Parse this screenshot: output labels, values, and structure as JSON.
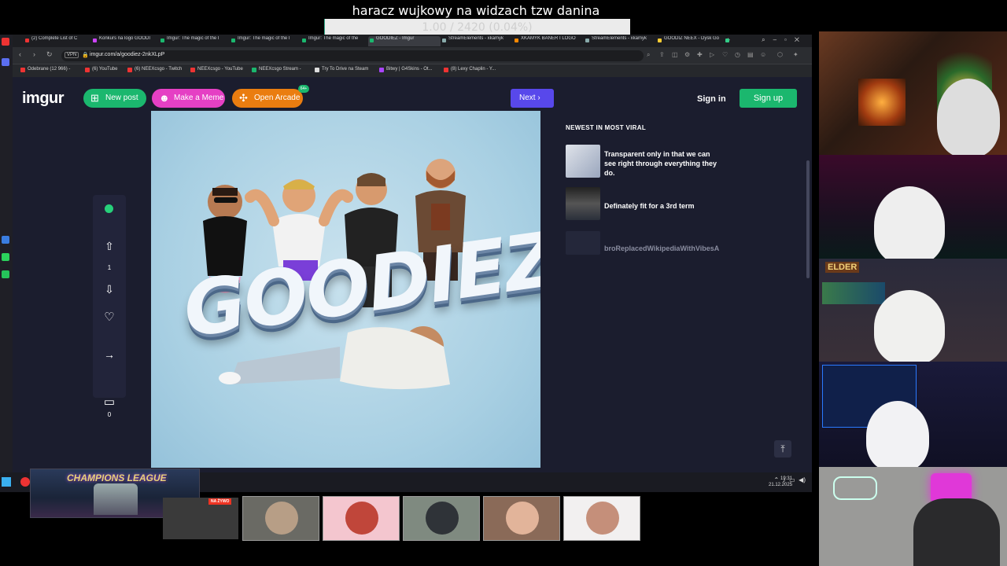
{
  "overlay": {
    "title": "haracz wujkowy na widzach tzw danina",
    "goal": "1.00 / 2420 (0.04%)",
    "goal_fraction": 0.0004
  },
  "browser": {
    "tabs": [
      {
        "label": "(2) Complete List of C"
      },
      {
        "label": "Konkurs na logo GOODI"
      },
      {
        "label": "Imgur: The magic of the I"
      },
      {
        "label": "Imgur: The magic of the I"
      },
      {
        "label": "Imgur: The magic of the"
      },
      {
        "label": "GOODIEZ - Imgur"
      },
      {
        "label": "StreamElements - xkamyk"
      },
      {
        "label": "XKAMYK BANER I LOGO"
      },
      {
        "label": "StreamElements - xkamyk"
      },
      {
        "label": "GOODIZ NEEX - Dysk Go"
      }
    ],
    "vpn_label": "VPN",
    "url": "imgur.com/a/goodiez-2nkXLpP",
    "bookmarks": [
      {
        "label": "Odebrane (12 966) -"
      },
      {
        "label": "(6) YouTube"
      },
      {
        "label": "(6) NEEXcsgo - Twitch"
      },
      {
        "label": "NEEXcsgo - YouTube"
      },
      {
        "label": "NEEXcsgo Stream -"
      },
      {
        "label": "Try To Drive na Steam"
      },
      {
        "label": "Bitwy | G4Skins - Ot..."
      },
      {
        "label": "(8) Lexy Chaplin - Y..."
      }
    ]
  },
  "imgur": {
    "logo": "imgur",
    "new_post": "New post",
    "make_meme": "Make a Meme",
    "open_arcade": "Open Arcade",
    "arcade_badge": "64+",
    "next": "Next",
    "sign_in": "Sign in",
    "sign_up": "Sign up",
    "post_image_text": "GOODIEZ",
    "vote_count": "1",
    "comment_count": "0",
    "sidebar_title": "NEWEST IN MOST VIRAL",
    "sidebar_items": [
      {
        "text": "Transparent only in that we can see right through everything they do."
      },
      {
        "text": "Definately fit for a 3rd term"
      },
      {
        "text": "broReplacedWikipediaWithVibesA"
      }
    ]
  },
  "taskbar": {
    "clock_time": "19:31",
    "clock_date": "21.12.2025",
    "champions_league": "CHAMPIONS LEAGUE",
    "live_badge": "NA ŻYWO"
  },
  "icons": {
    "upvote": "arrow-up-icon",
    "downvote": "arrow-down-icon",
    "favorite": "heart-icon",
    "share": "share-arrow-icon",
    "comment": "comment-icon"
  }
}
